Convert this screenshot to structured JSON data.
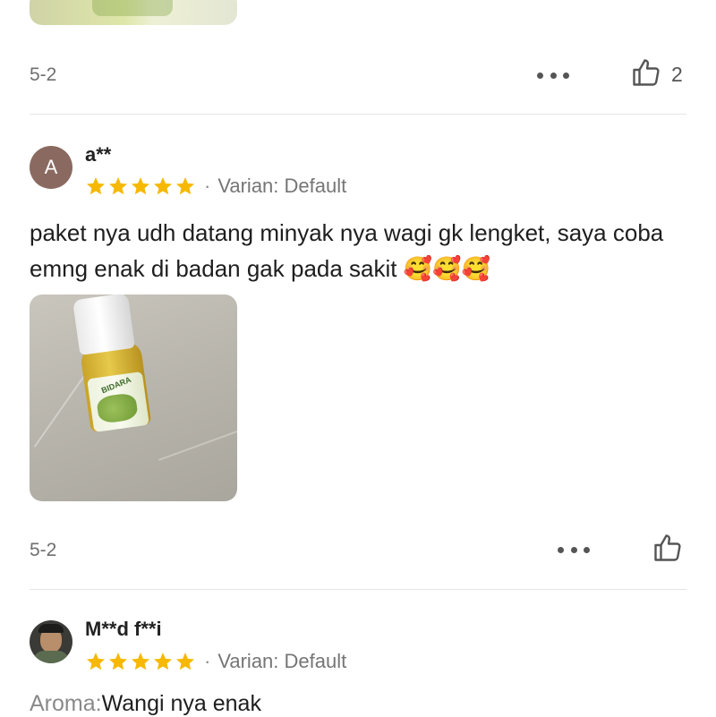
{
  "reviews": [
    {
      "date": "5-2",
      "like_count": "2"
    },
    {
      "avatar_initial": "A",
      "username": "a**",
      "rating": 5,
      "variant": "Varian: Default",
      "text": "paket nya udh datang minyak nya wagi gk lengket, saya coba emng enak di badan gak pada sakit 🥰🥰🥰",
      "photo_label": "BIDARA",
      "date": "5-2",
      "like_count": ""
    },
    {
      "username": "M**d f**i",
      "rating": 5,
      "variant": "Varian: Default",
      "aroma_label": "Aroma:",
      "aroma_value": "Wangi nya enak"
    }
  ],
  "icons": {
    "more": "more-dots-icon",
    "like": "thumbs-up-icon",
    "star": "star-icon"
  },
  "colors": {
    "star": "#F6B800",
    "avatar_a": "#8a6a60"
  }
}
